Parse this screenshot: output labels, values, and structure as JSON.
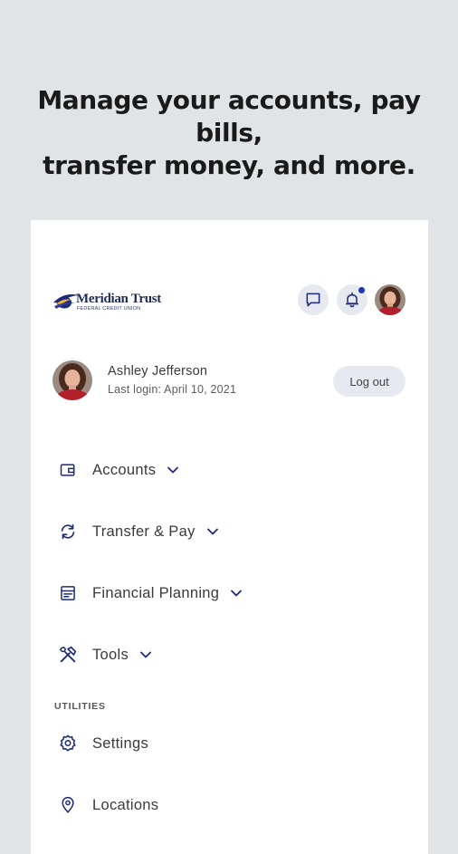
{
  "headline": {
    "line1": "Manage your accounts, pay bills,",
    "line2": "transfer money, and more."
  },
  "header": {
    "logo_name": "Meridian Trust",
    "logo_tagline": "FEDERAL CREDIT UNION",
    "icons": [
      "chat-icon",
      "bell-icon",
      "avatar"
    ],
    "notification_dot_color": "#1f35a8"
  },
  "profile": {
    "name": "Ashley Jefferson",
    "last_login": "Last login: April 10, 2021",
    "logout_label": "Log out"
  },
  "nav": {
    "items": [
      {
        "label": "Accounts",
        "icon": "wallet-icon",
        "expandable": true
      },
      {
        "label": "Transfer & Pay",
        "icon": "transfer-icon",
        "expandable": true
      },
      {
        "label": "Financial Planning",
        "icon": "planning-icon",
        "expandable": true
      },
      {
        "label": "Tools",
        "icon": "tools-icon",
        "expandable": true
      }
    ],
    "utilities_label": "UTILITIES",
    "utilities": [
      {
        "label": "Settings",
        "icon": "gear-icon"
      },
      {
        "label": "Locations",
        "icon": "location-pin-icon"
      }
    ]
  },
  "colors": {
    "accent": "#1d2b7c",
    "background": "#e1e4e6",
    "card": "#ffffff",
    "button_bg": "#e6e9ef"
  }
}
